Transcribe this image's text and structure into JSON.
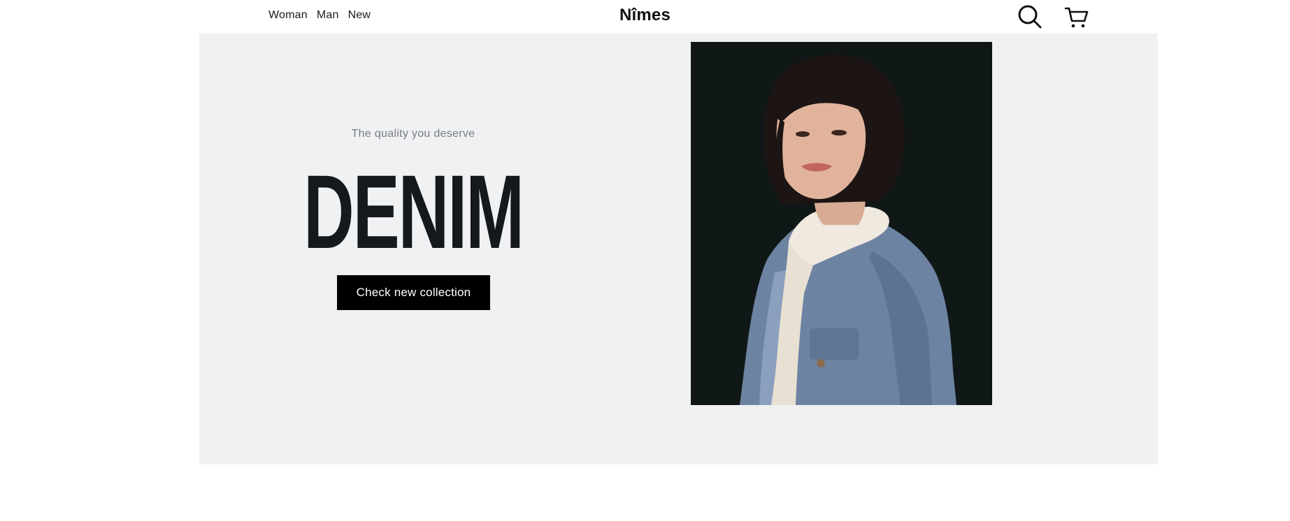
{
  "header": {
    "nav": [
      "Woman",
      "Man",
      "New"
    ],
    "brand": "Nîmes",
    "search_icon": "search-icon",
    "cart_icon": "cart-icon"
  },
  "hero": {
    "tagline": "The quality you deserve",
    "headline": "DENIM",
    "cta_label": "Check new collection",
    "image": "model-in-denim-jacket",
    "background_color": "#f0f1f3",
    "headline_color": "#15191e",
    "cta_color": "#000000"
  }
}
